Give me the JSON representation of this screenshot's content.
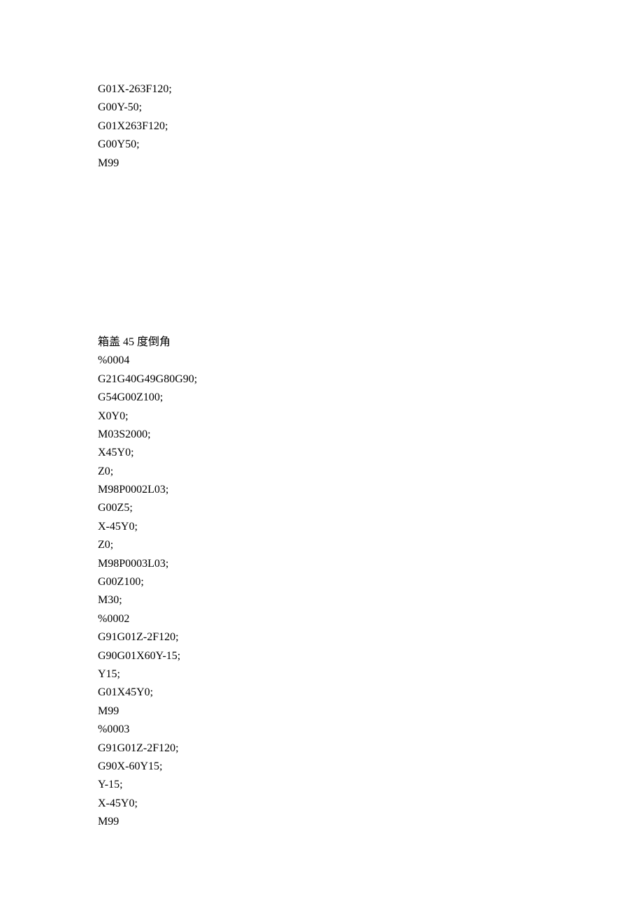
{
  "block1": {
    "lines": [
      "G01X-263F120;",
      "G00Y-50;",
      "G01X263F120;",
      "G00Y50;",
      "M99"
    ]
  },
  "block2": {
    "title_prefix": "箱盖 ",
    "title_num": "45",
    "title_suffix": " 度倒角",
    "lines": [
      "%0004",
      "G21G40G49G80G90;",
      "G54G00Z100;",
      "X0Y0;",
      "M03S2000;",
      "X45Y0;",
      "Z0;",
      "M98P0002L03;",
      "G00Z5;",
      "X-45Y0;",
      "Z0;",
      "M98P0003L03;",
      "G00Z100;",
      "M30;",
      "%0002",
      "G91G01Z-2F120;",
      "G90G01X60Y-15;",
      "Y15;",
      "G01X45Y0;",
      "M99",
      "%0003",
      "G91G01Z-2F120;",
      "G90X-60Y15;",
      "Y-15;",
      "X-45Y0;",
      "M99"
    ]
  }
}
